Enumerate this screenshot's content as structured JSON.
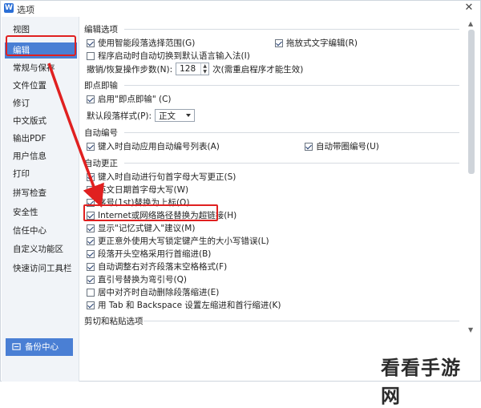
{
  "window": {
    "title": "选项",
    "app_icon": "W",
    "close_glyph": "✕"
  },
  "sidebar": {
    "items": [
      {
        "label": "视图"
      },
      {
        "label": "编辑"
      },
      {
        "label": "常规与保存"
      },
      {
        "label": "文件位置"
      },
      {
        "label": "修订"
      },
      {
        "label": "中文版式"
      },
      {
        "label": "输出PDF"
      },
      {
        "label": "用户信息"
      },
      {
        "label": "打印"
      },
      {
        "label": "拼写检查"
      },
      {
        "label": "安全性"
      },
      {
        "label": "信任中心"
      },
      {
        "label": "自定义功能区"
      },
      {
        "label": "快速访问工具栏"
      }
    ],
    "active_item": "编辑",
    "backup_label": "备份中心"
  },
  "sections": {
    "edit": {
      "title": "编辑选项",
      "smart_select": {
        "label": "使用智能段落选择范围(G)",
        "checked": true
      },
      "drag_text": {
        "label": "拖放式文字编辑(R)",
        "checked": true
      },
      "auto_switch_lang": {
        "label": "程序启动时自动切换到默认语言输入法(I)",
        "checked": false
      },
      "undo_steps": {
        "label": "撤销/恢复操作步数(N):",
        "value": "128",
        "note": "次(需重启程序才能生效)"
      }
    },
    "ime": {
      "title": "即点即输",
      "enable": {
        "label": "启用\"即点即输\" (C)",
        "checked": true
      },
      "default_style": {
        "label": "默认段落样式(P):",
        "value": "正文"
      }
    },
    "autonum": {
      "title": "自动编号",
      "apply_list": {
        "label": "键入时自动应用自动编号列表(A)",
        "checked": true
      },
      "auto_circle": {
        "label": "自动带圈编号(U)",
        "checked": true
      }
    },
    "autocorrect": {
      "title": "自动更正",
      "items": [
        {
          "label": "键入时自动进行句首字母大写更正(S)",
          "checked": true
        },
        {
          "label": "英文日期首字母大写(W)",
          "checked": true
        },
        {
          "label": "序号(1st)替换为上标(O)",
          "checked": true
        },
        {
          "label": "Internet或网络路径替换为超链接(H)",
          "checked": true
        },
        {
          "label": "显示\"记忆式键入\"建议(M)",
          "checked": true
        },
        {
          "label": "更正意外使用大写锁定键产生的大小写错误(L)",
          "checked": true
        },
        {
          "label": "段落开头空格采用行首缩进(B)",
          "checked": true
        },
        {
          "label": "自动调整右对齐段落末空格格式(F)",
          "checked": true
        },
        {
          "label": "直引号替换为弯引号(Q)",
          "checked": true
        },
        {
          "label": "居中对齐时自动删除段落缩进(E)",
          "checked": false
        },
        {
          "label": "用 Tab 和 Backspace 设置左缩进和首行缩进(K)",
          "checked": true
        }
      ]
    },
    "paste": {
      "title": "剪切和粘贴选项"
    }
  },
  "watermark": "看看手游网",
  "colors": {
    "accent": "#4a7fd4",
    "highlight": "#e02020",
    "arrow": "#e02020"
  }
}
